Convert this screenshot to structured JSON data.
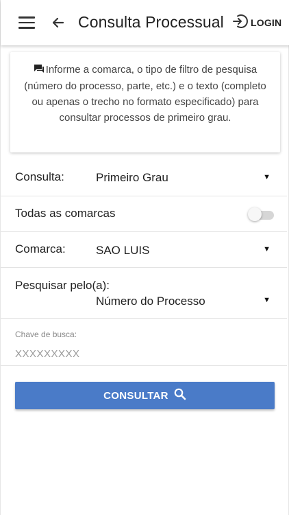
{
  "header": {
    "title": "Consulta Processual",
    "login_label": "LOGIN"
  },
  "info": {
    "text": "Informe a comarca, o tipo de filtro de pesquisa (número do processo, parte, etc.) e o texto (completo ou apenas o trecho no formato especificado) para consultar processos de primeiro grau."
  },
  "form": {
    "consulta": {
      "label": "Consulta:",
      "value": "Primeiro Grau"
    },
    "todas_comarcas": {
      "label": "Todas as comarcas",
      "enabled": false
    },
    "comarca": {
      "label": "Comarca:",
      "value": "SAO LUIS"
    },
    "pesquisar": {
      "label": "Pesquisar pelo(a):",
      "value": "Número do Processo"
    },
    "chave": {
      "label": "Chave de busca:",
      "placeholder": "XXXXXXXXX"
    }
  },
  "actions": {
    "consultar_label": "CONSULTAR"
  },
  "colors": {
    "primary_button": "#4a7bc8",
    "toggle_off": "#d6d6d6"
  },
  "icons": {
    "menu": "hamburger-menu-icon",
    "back": "arrow-left-icon",
    "login": "login-arrow-circle-icon",
    "info": "chat-bubble-icon",
    "dropdown": "caret-down-icon",
    "search": "search-icon"
  }
}
